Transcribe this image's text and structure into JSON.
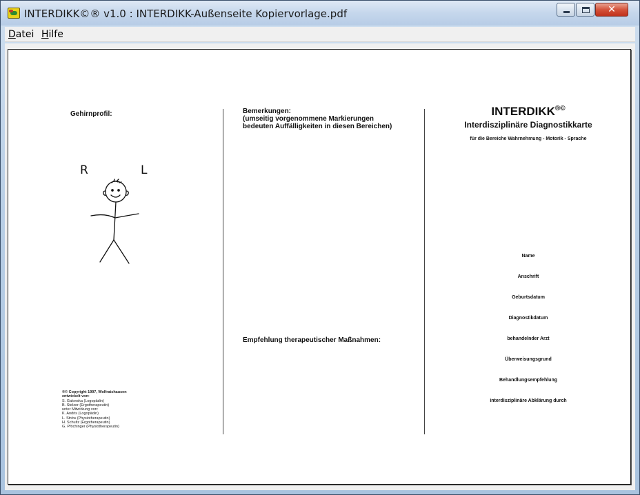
{
  "window": {
    "title": "INTERDIKK©® v1.0 : INTERDIKK-Außenseite Kopiervorlage.pdf",
    "controls": {
      "minimize": "minimize",
      "maximize": "maximize",
      "close": "✕"
    }
  },
  "menu": {
    "datei_first": "D",
    "datei_rest": "atei",
    "hilfe_first": "H",
    "hilfe_rest": "ilfe"
  },
  "document": {
    "left": {
      "heading": "Gehirnprofil:",
      "sketch_labels": {
        "r": "R",
        "l": "L"
      },
      "copyright": [
        {
          "text": "®© Copyright 1997, Wolfratshausen",
          "bold": true
        },
        {
          "text": "entwickelt von:",
          "bold": true
        },
        {
          "text": "S. Galonska   (Logopädin)",
          "bold": false
        },
        {
          "text": "B. Stelzer    (Ergotherapeutin)",
          "bold": false
        },
        {
          "text": "unter Mitwirkung von:",
          "bold": false
        },
        {
          "text": "K. Andris      (Logopädin)",
          "bold": false
        },
        {
          "text": "L. Ströw      (Physiotherapeutin)",
          "bold": false
        },
        {
          "text": "H. Schultz     (Ergotherapeutin)",
          "bold": false
        },
        {
          "text": "G. Pföchinger (Physiotherapeutin)",
          "bold": false
        }
      ]
    },
    "middle": {
      "remarks_title": "Bemerkungen:",
      "remarks_line2": "(umseitig vorgenommene Markierungen",
      "remarks_line3": "bedeuten Auffälligkeiten in diesen Bereichen)",
      "recommendation": "Empfehlung therapeutischer Maßnahmen:"
    },
    "right": {
      "brand": "INTERDIKK",
      "brand_mark": "®©",
      "subtitle": "Interdisziplinäre Diagnostikkarte",
      "areas": "für die Bereiche  Wahrnehmung - Motorik - Sprache",
      "fields": [
        "Name",
        "Anschrift",
        "Geburtsdatum",
        "Diagnostikdatum",
        "behandelnder Arzt",
        "Überweisungsgrund",
        "Behandlungsempfehlung",
        "interdisziplinäre Abklärung durch"
      ]
    }
  }
}
